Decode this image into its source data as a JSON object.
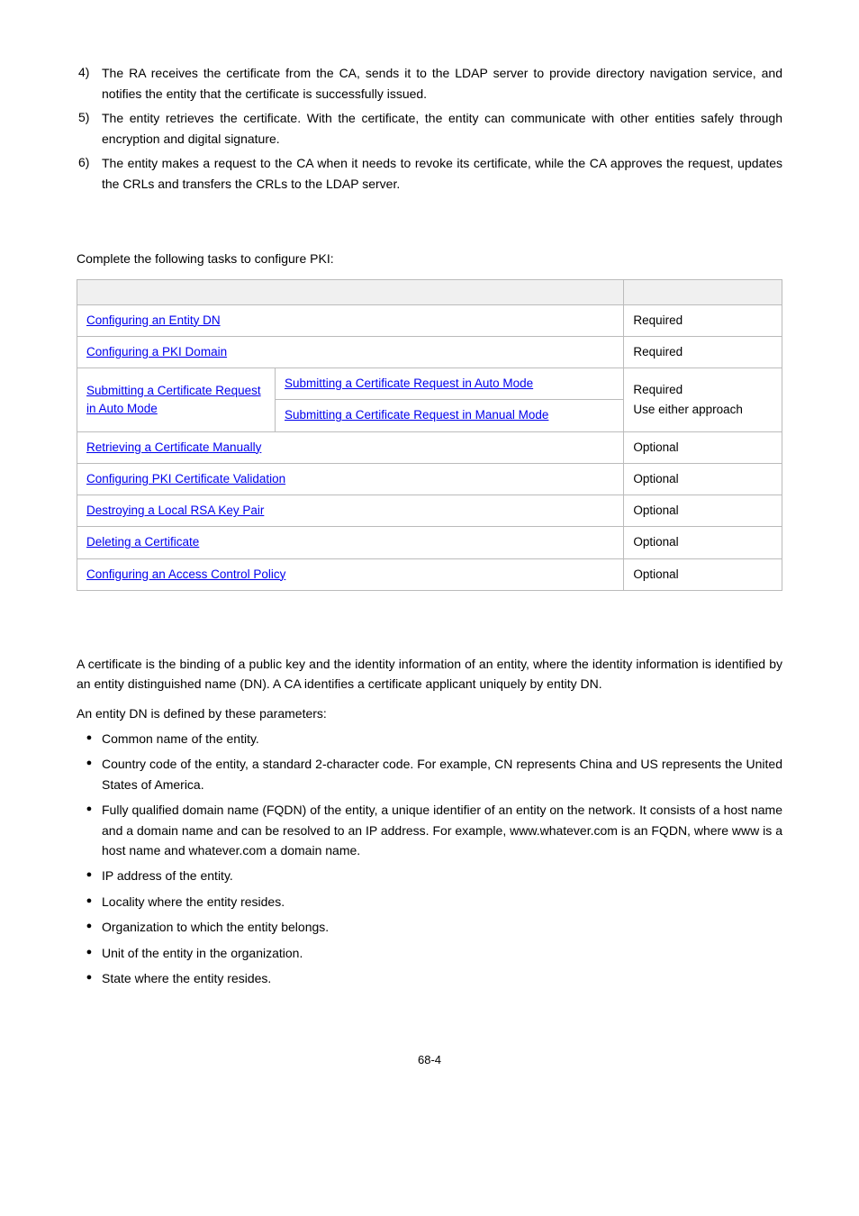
{
  "numbered": [
    {
      "n": "4)",
      "t": "The RA receives the certificate from the CA, sends it to the LDAP server to provide directory navigation service, and notifies the entity that the certificate is successfully issued."
    },
    {
      "n": "5)",
      "t": "The entity retrieves the certificate. With the certificate, the entity can communicate with other entities safely through encryption and digital signature."
    },
    {
      "n": "6)",
      "t": "The entity makes a request to the CA when it needs to revoke its certificate, while the CA approves the request, updates the CRLs and transfers the CRLs to the LDAP server."
    }
  ],
  "intro": "Complete the following tasks to configure PKI:",
  "table": {
    "header": {
      "task": "",
      "remarks": ""
    },
    "rows": {
      "r1_task": "Configuring an Entity DN",
      "r1_rem": "Required",
      "r2_task": "Configuring a PKI Domain",
      "r2_rem": "Required",
      "r3_task_left": "Submitting a Certificate Request in Auto Mode",
      "r3_task_right_a": "Submitting a Certificate Request in Auto Mode",
      "r3_task_right_b": "Submitting a Certificate Request in Manual Mode",
      "r3_rem_a": "Required",
      "r3_rem_b": "Use either approach",
      "r4_task": "Retrieving a Certificate Manually",
      "r4_rem": "Optional",
      "r5_task": "Configuring PKI Certificate Validation",
      "r5_rem": "Optional",
      "r6_task": "Destroying a Local RSA Key Pair",
      "r6_rem": "Optional",
      "r7_task": "Deleting a Certificate",
      "r7_rem": "Optional",
      "r8_task": "Configuring an Access Control Policy",
      "r8_rem": "Optional"
    }
  },
  "para1": "A certificate is the binding of a public key and the identity information of an entity, where the identity information is identified by an entity distinguished name (DN). A CA identifies a certificate applicant uniquely by entity DN.",
  "para2": "An entity DN is defined by these parameters:",
  "bullets": [
    "Common name of the entity.",
    "Country code of the entity, a standard 2-character code. For example, CN represents China and US represents the United States of America.",
    "Fully qualified domain name (FQDN) of the entity, a unique identifier of an entity on the network. It consists of a host name and a domain name and can be resolved to an IP address. For example, www.whatever.com is an FQDN, where www is a host name and whatever.com a domain name.",
    "IP address of the entity.",
    "Locality where the entity resides.",
    "Organization to which the entity belongs.",
    "Unit of the entity in the organization.",
    "State where the entity resides."
  ],
  "pagenum": "68-4"
}
